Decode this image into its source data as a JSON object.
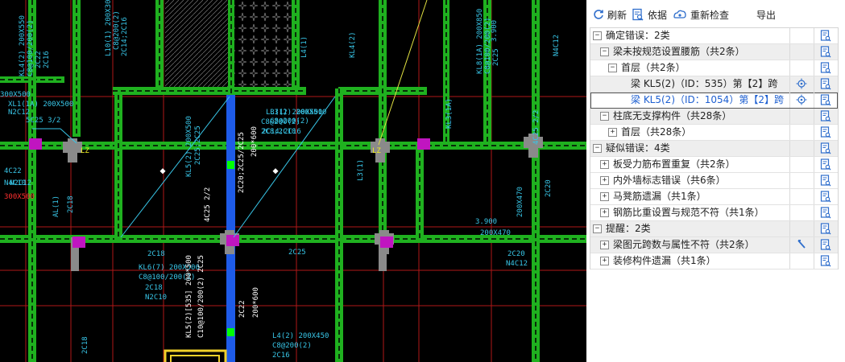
{
  "toolbar": {
    "refresh_label": "刷新",
    "basis_label": "依据",
    "recheck_label": "重新检查",
    "export_label": "导出"
  },
  "tree": [
    {
      "label": "确定错误：2类",
      "level": 0,
      "toggle": "−",
      "alt": false
    },
    {
      "label": "梁未按规范设置腰筋（共2条）",
      "level": 1,
      "toggle": "−",
      "alt": true
    },
    {
      "label": "首层（共2条）",
      "level": 2,
      "toggle": "−",
      "alt": false
    },
    {
      "label": "梁 KL5(2)（ID：535）第【2】跨",
      "level": 3,
      "toggle": "",
      "alt": true,
      "locate": true
    },
    {
      "label": "梁 KL5(2)（ID：1054）第【2】跨",
      "level": 3,
      "toggle": "",
      "alt": false,
      "locate": true,
      "selected": true,
      "blue": true
    },
    {
      "label": "柱底无支撑构件（共28条）",
      "level": 1,
      "toggle": "−",
      "alt": true
    },
    {
      "label": "首层（共28条）",
      "level": 2,
      "toggle": "+",
      "alt": false
    },
    {
      "label": "疑似错误：4类",
      "level": 0,
      "toggle": "−",
      "alt": true
    },
    {
      "label": "板受力筋布置重复（共2条）",
      "level": 1,
      "toggle": "+",
      "alt": false
    },
    {
      "label": "内外墙标志错误（共6条）",
      "level": 1,
      "toggle": "+",
      "alt": false
    },
    {
      "label": "马凳筋遗漏（共1条）",
      "level": 1,
      "toggle": "+",
      "alt": false
    },
    {
      "label": "钢筋比重设置与规范不符（共1条）",
      "level": 1,
      "toggle": "+",
      "alt": false
    },
    {
      "label": "提醒：2类",
      "level": 0,
      "toggle": "−",
      "alt": true
    },
    {
      "label": "梁图元跨数与属性不符（共2条）",
      "level": 1,
      "toggle": "+",
      "alt": true,
      "tool": true
    },
    {
      "label": "装修构件遗漏（共1条）",
      "level": 1,
      "toggle": "+",
      "alt": false
    }
  ],
  "cad": {
    "labels": [
      "KL4(2) 200X550",
      "C8@100/200(2)",
      "2C22",
      "2C16",
      "L10(1) 200X300",
      "C8@200(2)",
      "2C14;2C16",
      "L4(1)",
      "KL4(2)",
      "KL8(1A) 200X850",
      "C8@100/200(2)",
      "2C25",
      "N4C12",
      "XL1(1A) 200X500",
      "N2C12",
      "5C25 3/2",
      "LZ",
      "L3(1) 200X500",
      "C8@200(2)",
      "2C8;2C10",
      "KL5(2) 200X500",
      "2C25;2C25",
      "L3(2) 200X510",
      "C8@200(2)",
      "2C14;2C16",
      "2C20;2C25/2C25",
      "200*600",
      "KL3(1A)",
      "L3(1)",
      "4C25 2/2",
      "AL(1)",
      "2C18",
      "2C18",
      "KL6(7) 200X500",
      "C8@100/200(2)",
      "2C18",
      "N2C10",
      "KL5(2)[535] 200*500",
      "C10@100/200(2) 2C25",
      "2C22",
      "200*600",
      "L4(2) 200X450",
      "C8@200(2)",
      "2C16",
      "2C18",
      "2C20",
      "N4C12",
      "200X470",
      "4C25 2/2",
      "N2C12",
      "300X500",
      "4C22",
      "N4C10",
      "2C20",
      "300X500",
      "2C25",
      "3.900",
      "3.900",
      "200X470",
      "LZ"
    ]
  }
}
